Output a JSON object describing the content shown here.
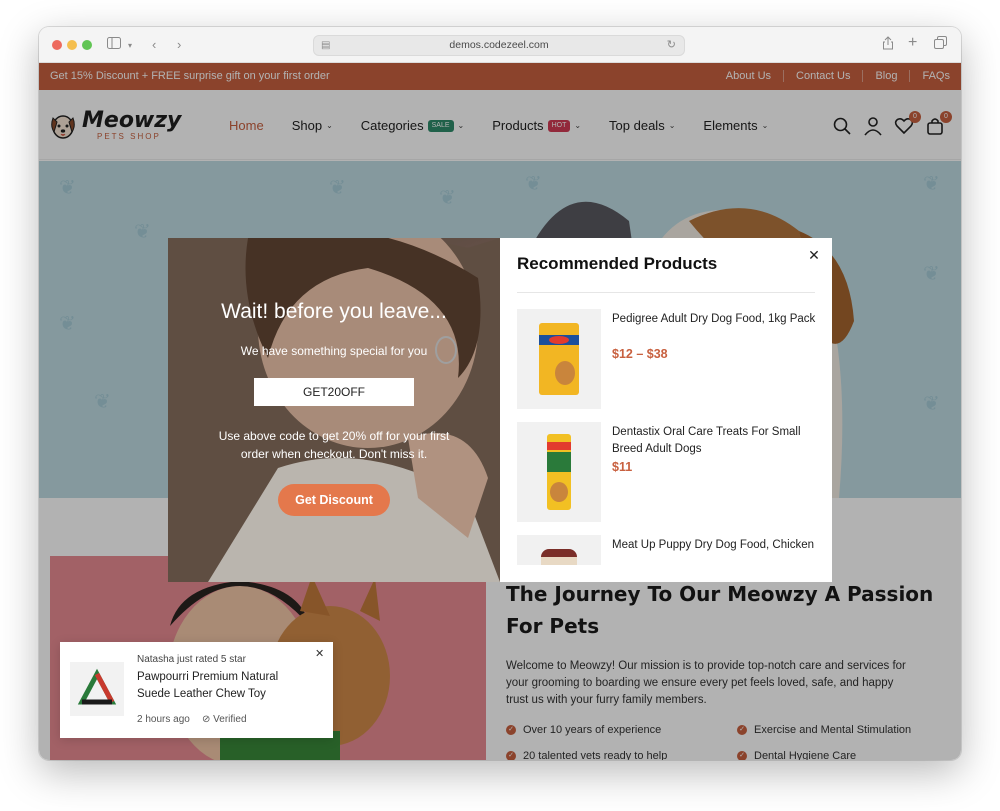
{
  "browser": {
    "url": "demos.codezeel.com"
  },
  "topbar": {
    "promo": "Get 15% Discount + FREE surprise gift on your first order",
    "links": [
      "About Us",
      "Contact Us",
      "Blog",
      "FAQs"
    ]
  },
  "header": {
    "logo_name": "Meowzy",
    "logo_sub": "PETS SHOP",
    "nav": [
      {
        "label": "Home",
        "active": true
      },
      {
        "label": "Shop"
      },
      {
        "label": "Categories",
        "badge": "SALE",
        "badge_color": "#2e8b6a"
      },
      {
        "label": "Products",
        "badge": "HOT",
        "badge_color": "#d23b55"
      },
      {
        "label": "Top deals"
      },
      {
        "label": "Elements"
      }
    ],
    "wishlist_count": "0",
    "cart_count": "0"
  },
  "popup": {
    "headline": "Wait! before you leave...",
    "subline": "We have something special for you",
    "coupon_code": "GET20OFF",
    "instructions": "Use above code to get 20% off for your first order when checkout. Don't miss it.",
    "cta": "Get Discount",
    "recommended_title": "Recommended Products",
    "products": [
      {
        "name": "Pedigree Adult Dry Dog Food, 1kg Pack",
        "price": "$12 – $38"
      },
      {
        "name": "Dentastix Oral Care Treats For Small Breed Adult Dogs",
        "price": "$11"
      },
      {
        "name": "Meat Up Puppy Dry Dog Food, Chicken",
        "price": ""
      }
    ]
  },
  "about": {
    "title": "The Journey To Our Meowzy A Passion For Pets",
    "text": "Welcome to Meowzy! Our mission is to provide top-notch care and services for your grooming to boarding we ensure every pet feels loved, safe, and happy trust us with your furry family members.",
    "features": [
      "Over 10 years of experience",
      "Exercise and Mental Stimulation",
      "20 talented vets ready to help",
      "Dental Hygiene Care"
    ]
  },
  "notification": {
    "line1": "Natasha just rated 5 star",
    "product": "Pawpourri Premium Natural Suede Leather Chew Toy",
    "time": "2 hours ago",
    "verified": "Verified"
  },
  "colors": {
    "brand": "#c8603f",
    "cta": "#e4784c",
    "hero_bg": "#bfdbe3"
  }
}
